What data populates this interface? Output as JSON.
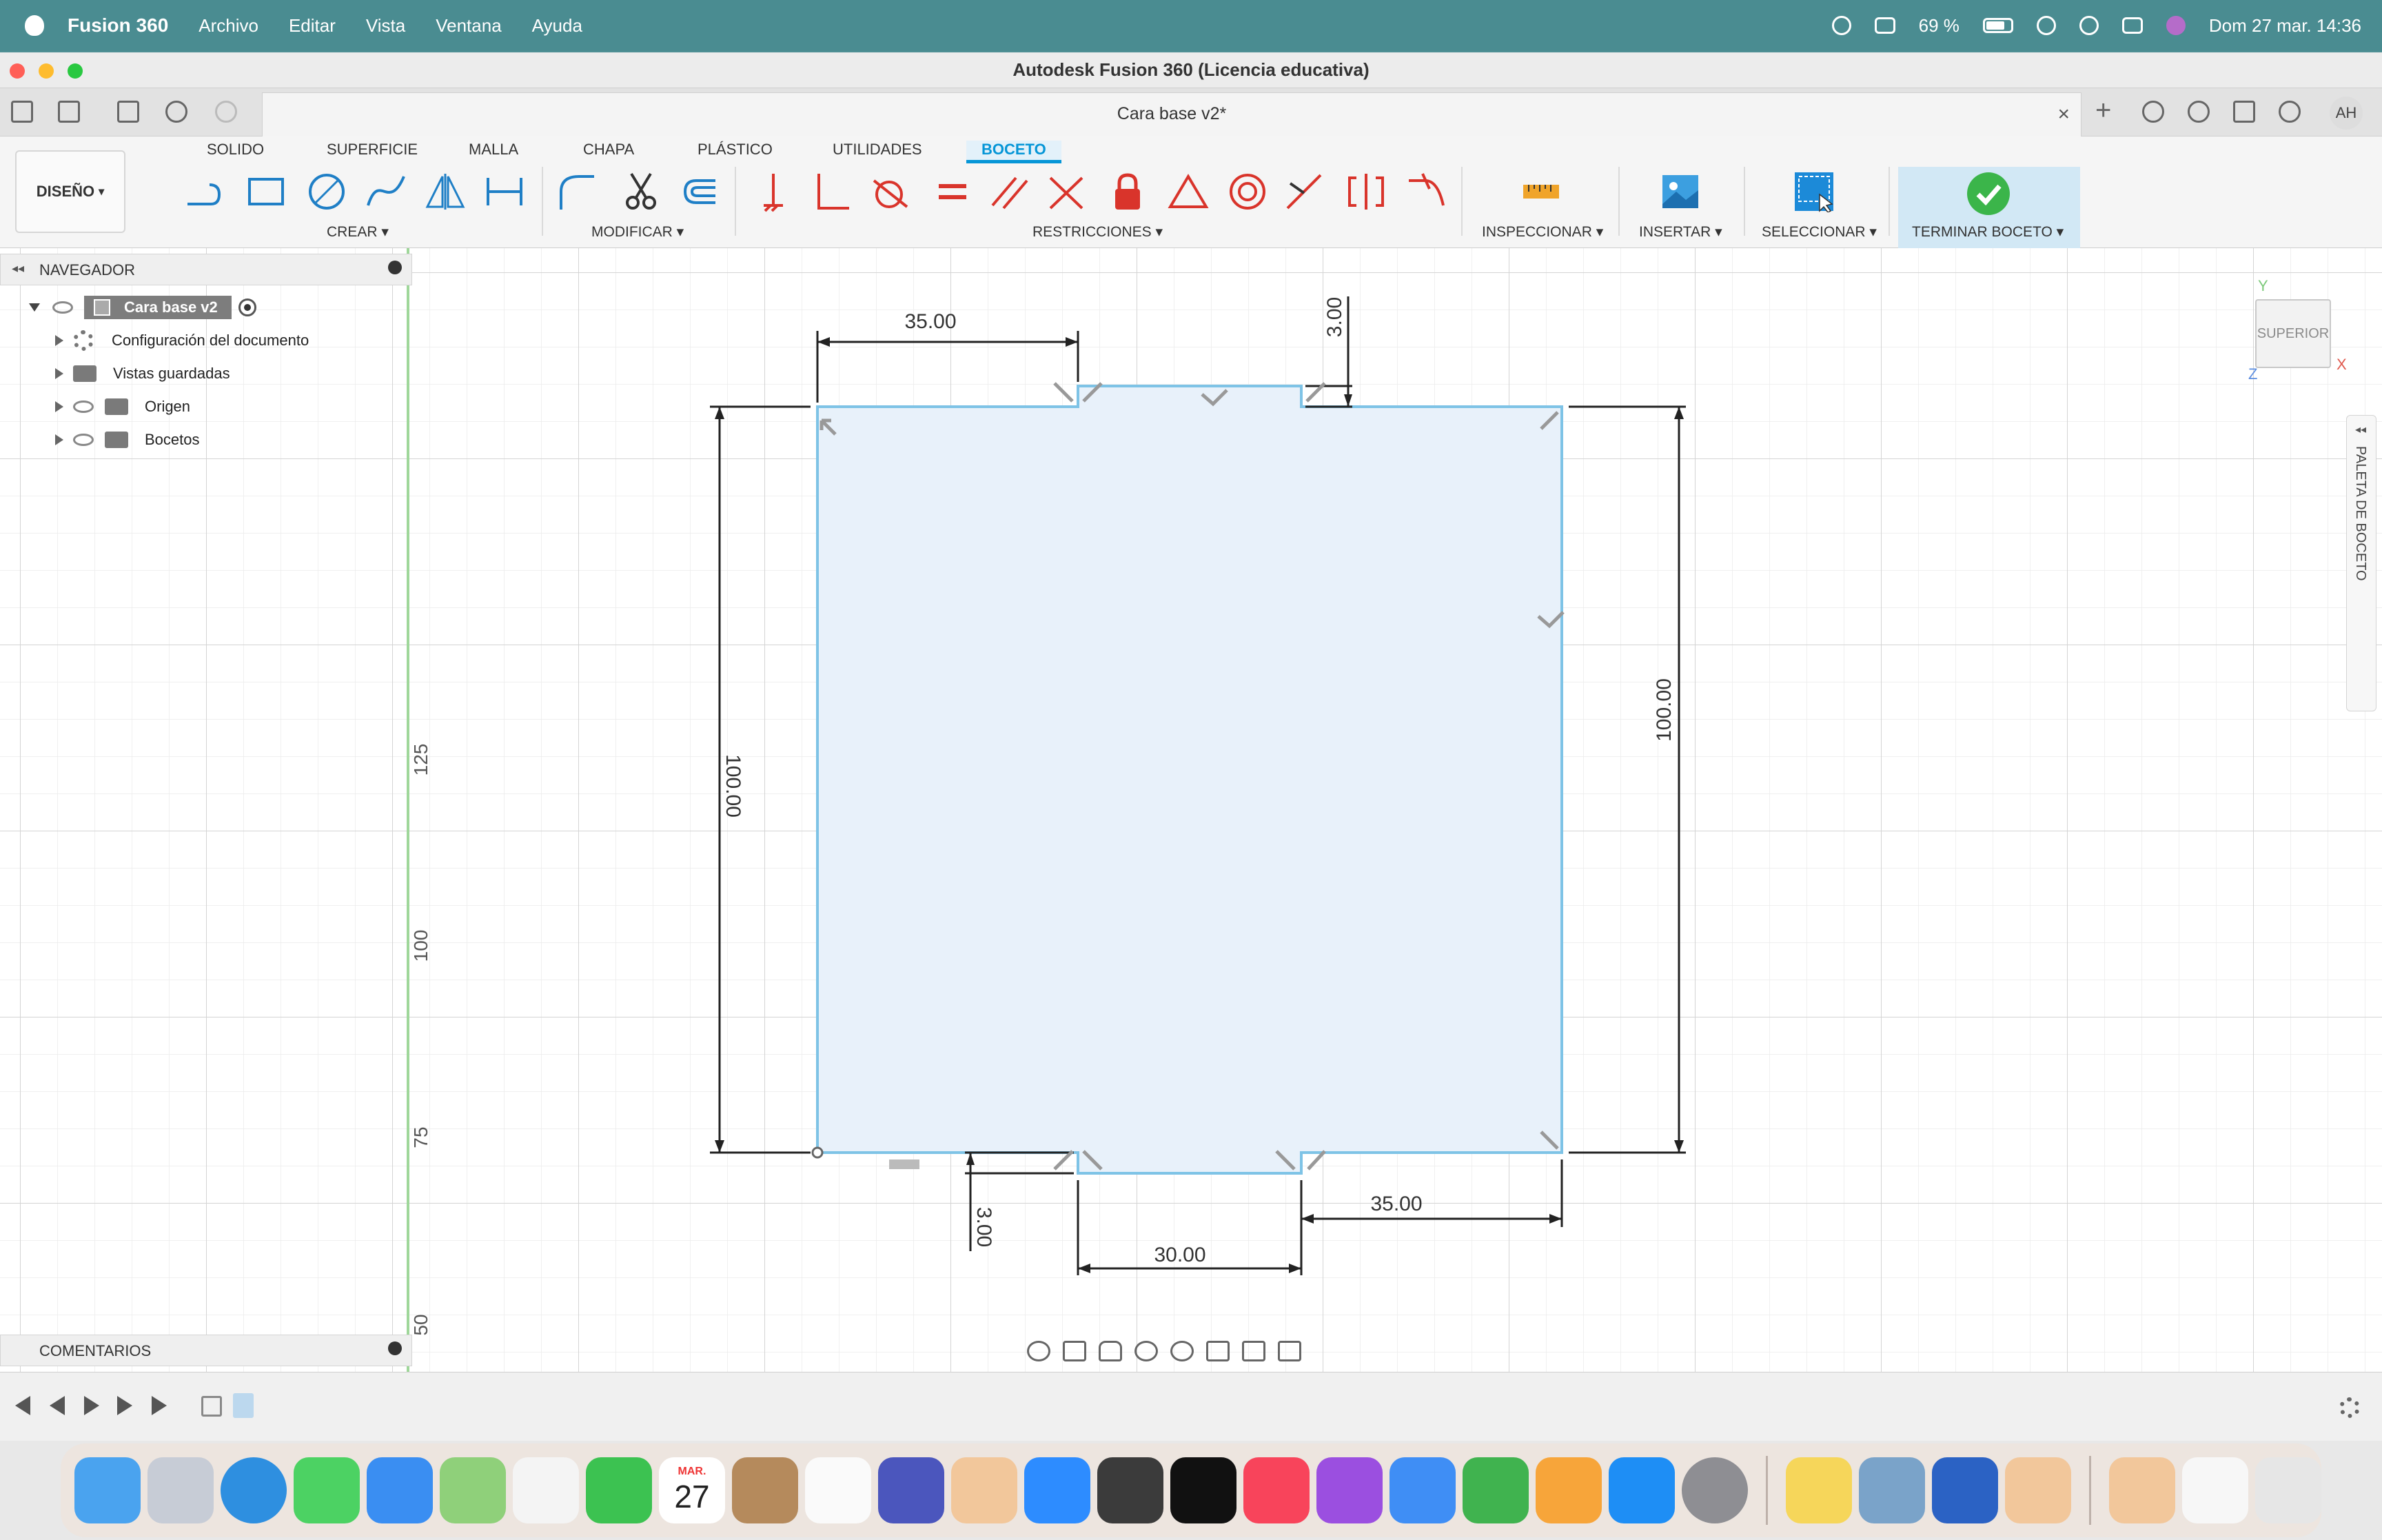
{
  "menubar": {
    "app_name": "Fusion 360",
    "items": [
      "Archivo",
      "Editar",
      "Vista",
      "Ventana",
      "Ayuda"
    ],
    "battery": "69 %",
    "clock": "Dom 27 mar.  14:36"
  },
  "window": {
    "title": "Autodesk Fusion 360 (Licencia educativa)",
    "doc_tab": "Cara base v2*",
    "user_initials": "AH"
  },
  "ribbon": {
    "workspace": "DISEÑO",
    "tabs": [
      "SOLIDO",
      "SUPERFICIE",
      "MALLA",
      "CHAPA",
      "PLÁSTICO",
      "UTILIDADES",
      "BOCETO"
    ],
    "active_tab": "BOCETO",
    "groups": {
      "create": "CREAR",
      "modify": "MODIFICAR",
      "constraints": "RESTRICCIONES",
      "inspect": "INSPECCIONAR",
      "insert": "INSERTAR",
      "select": "SELECCIONAR",
      "finish": "TERMINAR BOCETO"
    }
  },
  "browser": {
    "header": "NAVEGADOR",
    "root": "Cara base v2",
    "items": [
      "Configuración del documento",
      "Vistas guardadas",
      "Origen",
      "Bocetos"
    ]
  },
  "comments": {
    "header": "COMENTARIOS"
  },
  "sketch": {
    "dimensions": {
      "top_left_width": "35.00",
      "top_notch_depth": "3.00",
      "left_height": "100.00",
      "right_height": "100.00",
      "bottom_notch_depth": "3.00",
      "bottom_middle_width": "30.00",
      "bottom_right_width": "35.00"
    },
    "axis_labels": [
      "125",
      "100",
      "75",
      "50"
    ]
  },
  "viewcube": {
    "face": "SUPERIOR",
    "axis_x": "X",
    "axis_y": "Y",
    "axis_z": "Z"
  },
  "palette": {
    "label": "PALETA DE BOCETO"
  },
  "dock": {
    "calendar_month": "MAR.",
    "calendar_day": "27"
  },
  "colors": {
    "accent": "#0696d7",
    "sketch_fill": "#e8f1fa",
    "sketch_line": "#7ec3e6",
    "finish_check": "#3bb54a"
  }
}
